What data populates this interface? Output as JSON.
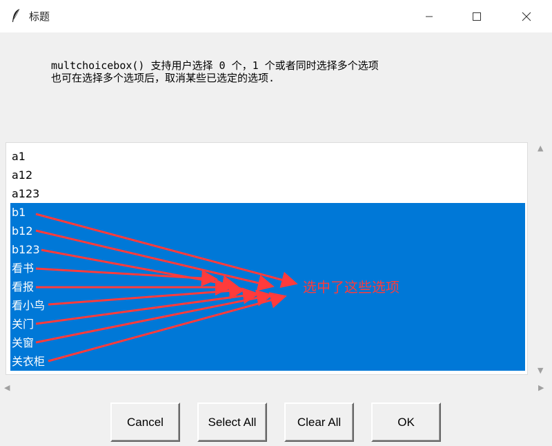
{
  "window": {
    "title": "标题",
    "icons": [
      "feather-icon",
      "minimize-icon",
      "maximize-icon",
      "close-icon"
    ]
  },
  "message": {
    "line1": "multchoicebox() 支持用户选择 0 个，1 个或者同时选择多个选项",
    "line2": "也可在选择多个选项后，取消某些已选定的选项."
  },
  "list": {
    "items": [
      {
        "label": "a1",
        "selected": false
      },
      {
        "label": "a12",
        "selected": false
      },
      {
        "label": "a123",
        "selected": false
      },
      {
        "label": "b1",
        "selected": true
      },
      {
        "label": "b12",
        "selected": true
      },
      {
        "label": "b123",
        "selected": true
      },
      {
        "label": "看书",
        "selected": true
      },
      {
        "label": "看报",
        "selected": true
      },
      {
        "label": "看小鸟",
        "selected": true
      },
      {
        "label": "关门",
        "selected": true
      },
      {
        "label": "关窗",
        "selected": true
      },
      {
        "label": "关衣柜",
        "selected": true
      }
    ],
    "selection_color": "#0078d7"
  },
  "annotation": {
    "text": "选中了这些选项",
    "color": "#ff3b3b"
  },
  "buttons": {
    "cancel": "Cancel",
    "select_all": "Select All",
    "clear_all": "Clear All",
    "ok": "OK"
  }
}
